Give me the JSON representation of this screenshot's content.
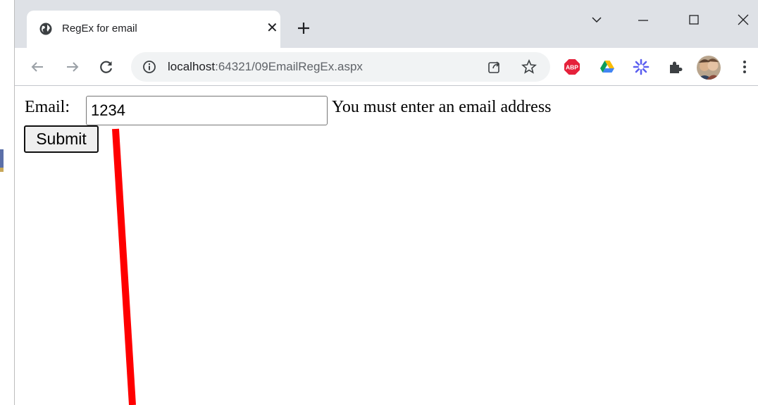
{
  "browser": {
    "tab_title": "RegEx for email",
    "url_host": "localhost",
    "url_path": ":64321/09EmailRegEx.aspx"
  },
  "form": {
    "email_label": "Email:",
    "email_value": "1234",
    "validation_message": "You must enter an email address",
    "submit_label": "Submit"
  },
  "extensions": {
    "abp_label": "ABP"
  },
  "colors": {
    "annotation_line": "#ff0000",
    "abp_red": "#e5213b"
  }
}
